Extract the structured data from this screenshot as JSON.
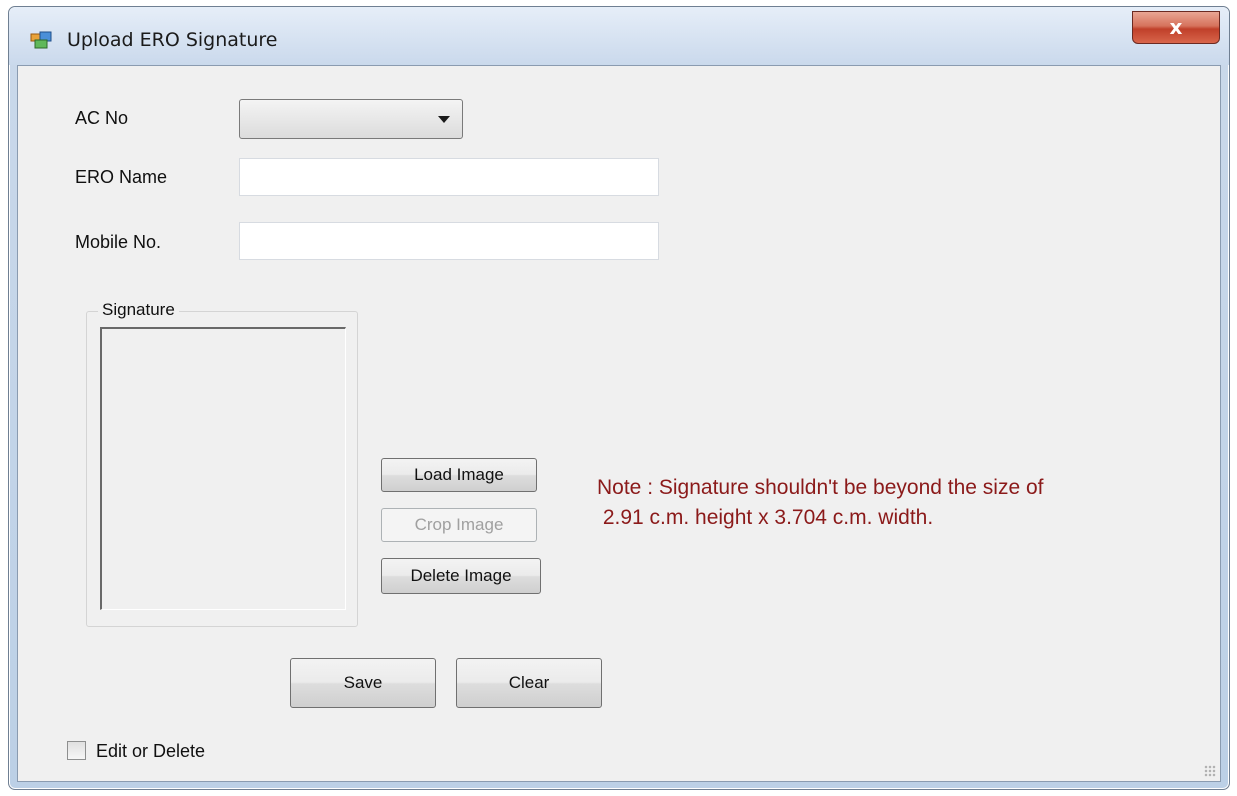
{
  "window": {
    "title": "Upload ERO Signature",
    "close_symbol": "x",
    "app_icon": "form-icon"
  },
  "form": {
    "ac_no_label": "AC No",
    "ac_no_value": "",
    "ero_name_label": "ERO Name",
    "ero_name_value": "",
    "mobile_no_label": "Mobile No.",
    "mobile_no_value": ""
  },
  "signature": {
    "group_label": "Signature",
    "load_button": "Load Image",
    "crop_button": "Crop Image",
    "delete_button": "Delete Image",
    "note_line1": "Note : Signature shouldn't be beyond the size of",
    "note_line2": " 2.91 c.m. height x 3.704 c.m. width."
  },
  "actions": {
    "save_button": "Save",
    "clear_button": "Clear"
  },
  "options": {
    "edit_or_delete_label": "Edit or Delete",
    "edit_or_delete_checked": false
  },
  "colors": {
    "note": "#8b1a1a",
    "client_bg": "#f0f0f0",
    "close_button": "#c9432d"
  }
}
